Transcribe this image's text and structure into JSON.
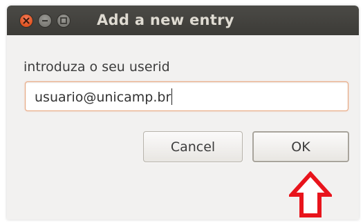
{
  "dialog": {
    "title": "Add a new entry",
    "prompt": "introduza o seu userid",
    "userid_value": "usuario@unicamp.br",
    "cancel_label": "Cancel",
    "ok_label": "OK"
  },
  "colors": {
    "titlebar": "#3c3b37",
    "close_button": "#e0531f",
    "input_focus_border": "#e9a77f",
    "annotation_arrow": "#e8141c"
  },
  "icons": {
    "close": "close-icon",
    "minimize": "minimize-icon",
    "maximize": "maximize-icon",
    "annotation": "up-arrow-icon"
  }
}
